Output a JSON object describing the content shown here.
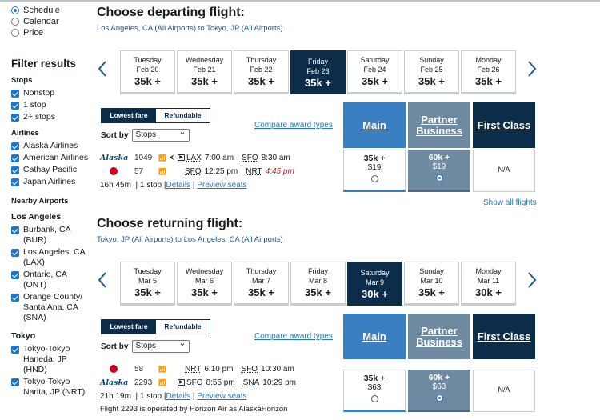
{
  "sort_options": [
    {
      "label": "Schedule",
      "selected": true
    },
    {
      "label": "Calendar",
      "selected": false
    },
    {
      "label": "Price",
      "selected": false
    }
  ],
  "filters": {
    "title": "Filter results",
    "stops_title": "Stops",
    "stops": [
      "Nonstop",
      "1 stop",
      "2+ stops"
    ],
    "airlines_title": "Airlines",
    "airlines": [
      "Alaska Airlines",
      "American Airlines",
      "Cathay Pacific",
      "Japan Airlines"
    ],
    "nearby_title": "Nearby Airports",
    "la_title": "Los Angeles",
    "la_airports": [
      "Burbank, CA (BUR)",
      "Los Angeles, CA (LAX)",
      "Ontario, CA (ONT)",
      "Orange County/ Santa Ana, CA (SNA)"
    ],
    "tokyo_title": "Tokyo",
    "tokyo_airports": [
      "Tokyo-Tokyo Haneda, JP (HND)",
      "Tokyo-Tokyo Narita, JP (NRT)"
    ]
  },
  "departing": {
    "heading": "Choose departing flight:",
    "route": "Los Angeles, CA (All Airports) to Tokyo, JP (All Airports)",
    "dates": [
      {
        "day": "Tuesday",
        "date": "Feb 20",
        "price": "35k +"
      },
      {
        "day": "Wednesday",
        "date": "Feb 21",
        "price": "35k +"
      },
      {
        "day": "Thursday",
        "date": "Feb 22",
        "price": "35k +"
      },
      {
        "day": "Friday",
        "date": "Feb 23",
        "price": "35k +",
        "selected": true
      },
      {
        "day": "Saturday",
        "date": "Feb 24",
        "price": "35k +"
      },
      {
        "day": "Sunday",
        "date": "Feb 25",
        "price": "35k +"
      },
      {
        "day": "Monday",
        "date": "Feb 26",
        "price": "35k +"
      }
    ],
    "fare_tabs": [
      "Lowest fare",
      "Refundable"
    ],
    "sort_label": "Sort by",
    "sort_value": "Stops",
    "compare_link": "Compare award types",
    "cabins": [
      "Main",
      "Partner Business",
      "First Class"
    ],
    "segments": [
      {
        "airline": "Alaska",
        "flight": "1049",
        "from": "LAX",
        "dep": "7:00 am",
        "to": "SFO",
        "arr": "8:30 am"
      },
      {
        "airline": "JAL",
        "flight": "57",
        "from": "SFO",
        "dep": "12:25 pm",
        "to": "NRT",
        "arr": "4:45 pm"
      }
    ],
    "duration": "16h 45m",
    "stops": "1 stop",
    "details_link": "Details",
    "seats_link": "Preview seats",
    "fares": [
      {
        "points": "35k +",
        "tax": "$19",
        "selected": false
      },
      {
        "points": "60k +",
        "tax": "$19",
        "selected": true
      },
      {
        "na": "N/A"
      }
    ],
    "show_all": "Show all flights"
  },
  "returning": {
    "heading": "Choose returning flight:",
    "route": "Tokyo, JP (All Airports) to Los Angeles, CA (All Airports)",
    "dates": [
      {
        "day": "Tuesday",
        "date": "Mar 5",
        "price": "35k +"
      },
      {
        "day": "Wednesday",
        "date": "Mar 6",
        "price": "35k +"
      },
      {
        "day": "Thursday",
        "date": "Mar 7",
        "price": "35k +"
      },
      {
        "day": "Friday",
        "date": "Mar 8",
        "price": "35k +"
      },
      {
        "day": "Saturday",
        "date": "Mar 9",
        "price": "30k +",
        "selected": true
      },
      {
        "day": "Sunday",
        "date": "Mar 10",
        "price": "35k +"
      },
      {
        "day": "Monday",
        "date": "Mar 11",
        "price": "30k +"
      }
    ],
    "fare_tabs": [
      "Lowest fare",
      "Refundable"
    ],
    "sort_label": "Sort by",
    "sort_value": "Stops",
    "compare_link": "Compare award types",
    "cabins": [
      "Main",
      "Partner Business",
      "First Class"
    ],
    "segments": [
      {
        "airline": "JAL",
        "flight": "58",
        "from": "NRT",
        "dep": "6:10 pm",
        "to": "SFO",
        "arr": "10:30 am"
      },
      {
        "airline": "Alaska",
        "flight": "2293",
        "from": "SFO",
        "dep": "8:55 pm",
        "to": "SNA",
        "arr": "10:29 pm"
      }
    ],
    "duration": "21h 19m",
    "stops": "1 stop",
    "details_link": "Details",
    "seats_link": "Preview seats",
    "operated_note": "Flight 2293 is operated by Horizon Air as AlaskaHorizon",
    "fares": [
      {
        "points": "35k +",
        "tax": "$63",
        "selected": false
      },
      {
        "points": "60k +",
        "tax": "$63",
        "selected": true
      },
      {
        "na": "N/A"
      }
    ]
  }
}
